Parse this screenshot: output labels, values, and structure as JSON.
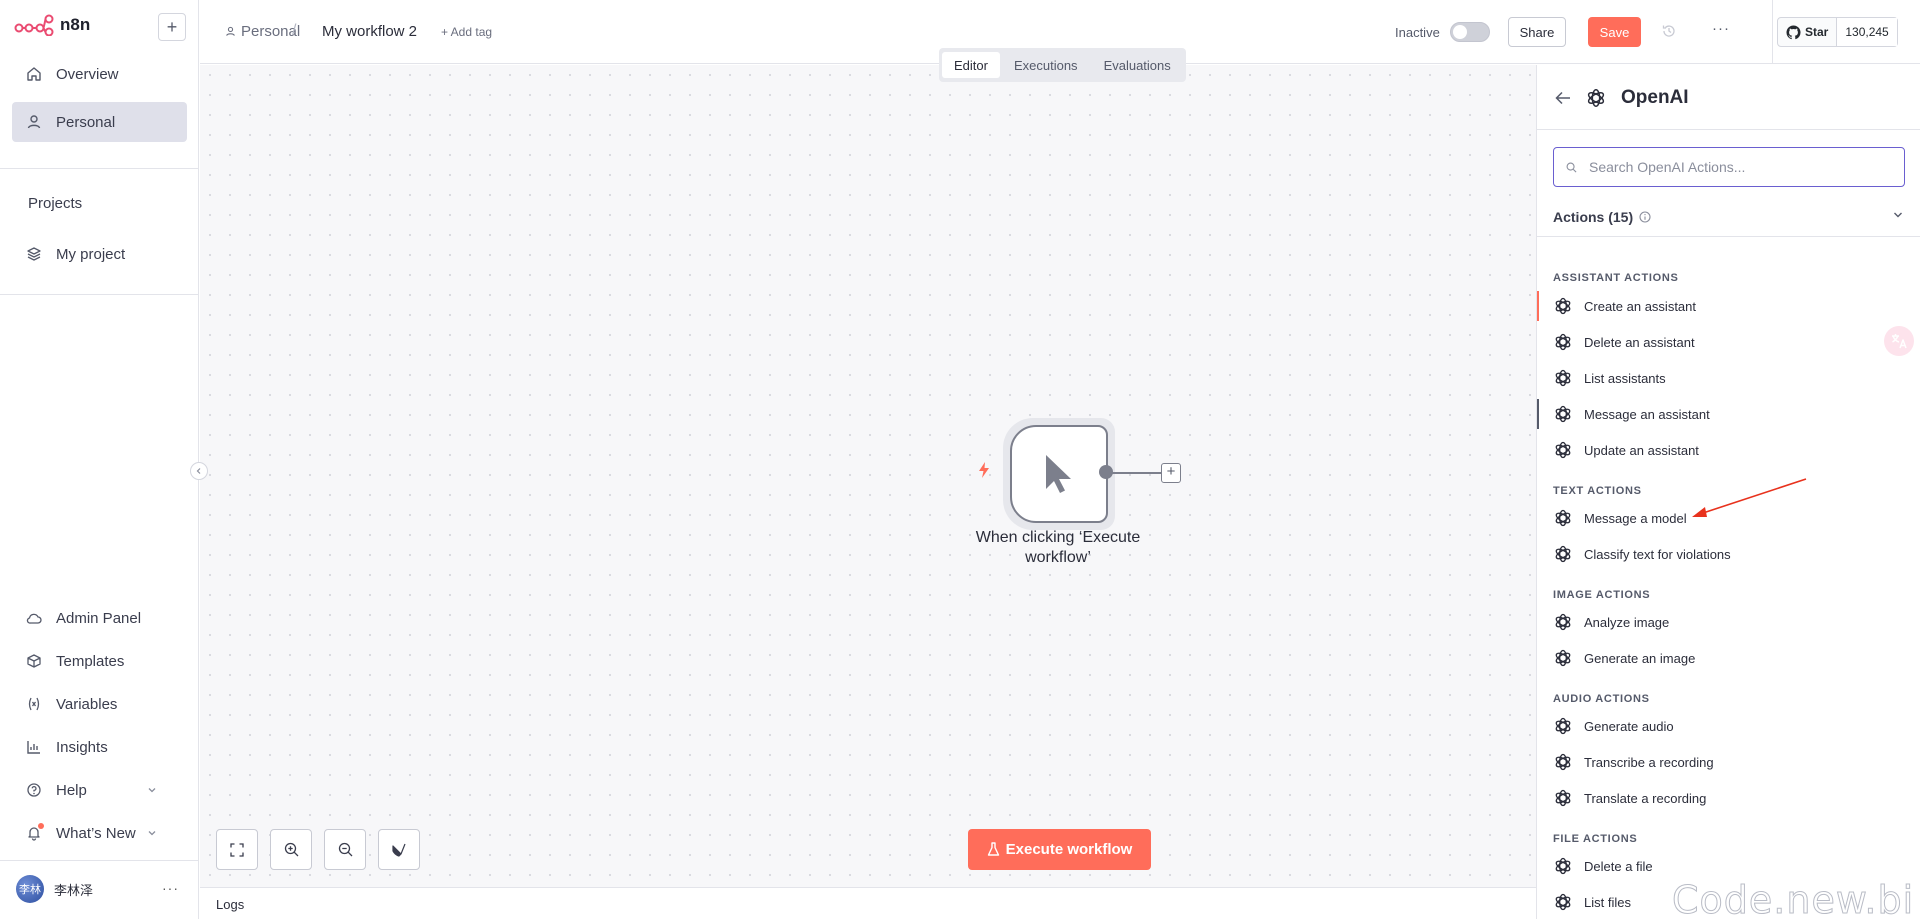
{
  "app": {
    "logo_text": "n8n",
    "accent": "#ff6d5a"
  },
  "sidebar": {
    "add_label": "+",
    "top_items": [
      {
        "label": "Overview",
        "icon": "home-icon"
      },
      {
        "label": "Personal",
        "icon": "user-icon",
        "active": true
      }
    ],
    "projects_title": "Projects",
    "project_items": [
      {
        "label": "My project",
        "icon": "layers-icon"
      }
    ],
    "bottom_items": [
      {
        "label": "Admin Panel",
        "icon": "cloud-icon"
      },
      {
        "label": "Templates",
        "icon": "box-icon"
      },
      {
        "label": "Variables",
        "icon": "variable-icon"
      },
      {
        "label": "Insights",
        "icon": "bar-chart-icon"
      },
      {
        "label": "Help",
        "icon": "help-circle-icon",
        "has_chevron": true
      },
      {
        "label": "What’s New",
        "icon": "bell-icon",
        "has_chevron": true,
        "has_badge": true
      }
    ],
    "user": {
      "avatar_text": "李林",
      "name": "李林泽",
      "menu": "···"
    }
  },
  "header": {
    "breadcrumb_project": "Personal",
    "breadcrumb_sep": "/",
    "workflow_name": "My workflow 2",
    "add_tag": "+ Add tag",
    "status_label": "Inactive",
    "share_label": "Share",
    "save_label": "Save",
    "more_label": "···",
    "github": {
      "star_label": "Star",
      "count": "130,245"
    }
  },
  "canvas": {
    "tabs": [
      {
        "label": "Editor",
        "active": true
      },
      {
        "label": "Executions"
      },
      {
        "label": "Evaluations"
      }
    ],
    "trigger_node": {
      "label": "When clicking ‘Execute workflow’"
    },
    "node_add": "+",
    "execute_label": "Execute workflow",
    "logs_label": "Logs"
  },
  "panel": {
    "title": "OpenAI",
    "search_placeholder": "Search OpenAI Actions...",
    "actions_header": "Actions (15)",
    "groups": [
      {
        "title": "ASSISTANT ACTIONS",
        "items": [
          "Create an assistant",
          "Delete an assistant",
          "List assistants",
          "Message an assistant",
          "Update an assistant"
        ]
      },
      {
        "title": "TEXT ACTIONS",
        "items": [
          "Message a model",
          "Classify text for violations"
        ]
      },
      {
        "title": "IMAGE ACTIONS",
        "items": [
          "Analyze image",
          "Generate an image"
        ]
      },
      {
        "title": "AUDIO ACTIONS",
        "items": [
          "Generate audio",
          "Transcribe a recording",
          "Translate a recording"
        ]
      },
      {
        "title": "FILE ACTIONS",
        "items": [
          "Delete a file",
          "List files"
        ]
      }
    ]
  },
  "watermark": "Code.new.bi"
}
